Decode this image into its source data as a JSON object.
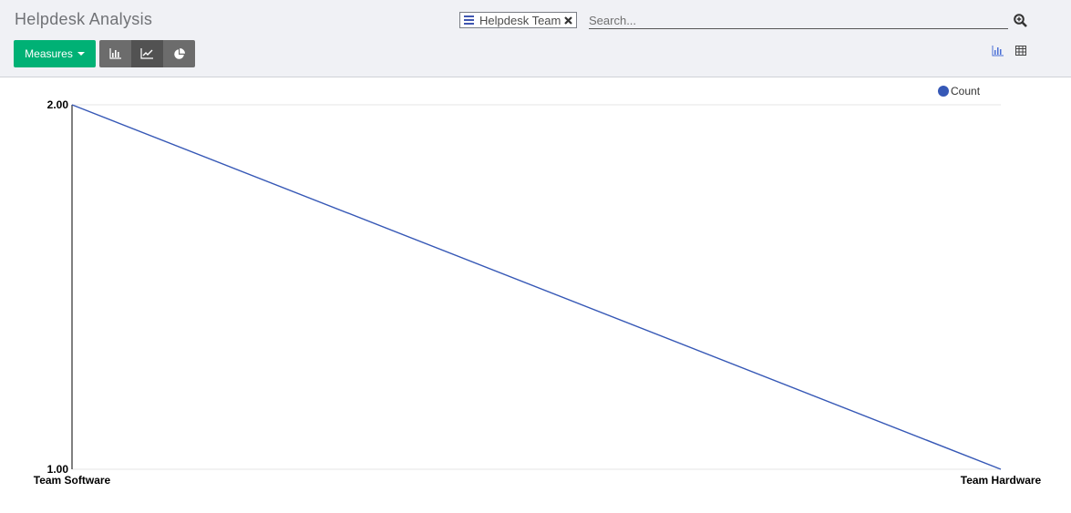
{
  "header": {
    "title": "Helpdesk Analysis"
  },
  "toolbar": {
    "measures_label": "Measures",
    "view_types": [
      {
        "name": "bar",
        "icon": "bar-chart-icon",
        "active": false
      },
      {
        "name": "line",
        "icon": "line-chart-icon",
        "active": true
      },
      {
        "name": "pie",
        "icon": "pie-chart-icon",
        "active": false
      }
    ]
  },
  "search": {
    "facet": {
      "icon": "group-by-icon",
      "label": "Helpdesk Team",
      "remove_icon": "close-icon"
    },
    "placeholder": "Search...",
    "search_icon": "zoom-icon"
  },
  "view_switcher": [
    {
      "name": "graph",
      "icon": "bar-chart-icon",
      "active": true
    },
    {
      "name": "pivot",
      "icon": "table-icon",
      "active": false
    }
  ],
  "colors": {
    "primary": "#00b175",
    "series": "#3658b6",
    "control_panel": "#f0f1f5"
  },
  "chart_data": {
    "type": "line",
    "categories": [
      "Team Software",
      "Team Hardware"
    ],
    "series": [
      {
        "name": "Count",
        "values": [
          2,
          1
        ]
      }
    ],
    "ylim": [
      1,
      2
    ],
    "y_ticks": [
      "1.00",
      "2.00"
    ],
    "legend_position": "top-right",
    "grid": true
  }
}
